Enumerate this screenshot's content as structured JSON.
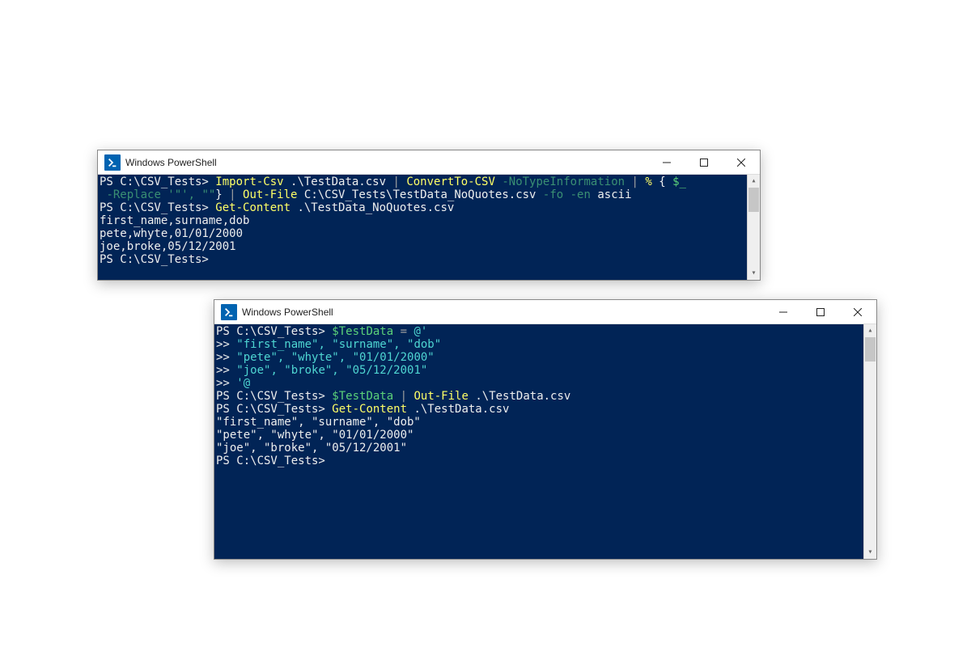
{
  "window_title": "Windows PowerShell",
  "prompt": "PS C:\\CSV_Tests>",
  "continuation_prompt": ">>",
  "windows": {
    "w1": {
      "lines": [
        {
          "type": "cmd",
          "segments": [
            {
              "cls": "ps-white",
              "t": "PS C:\\CSV_Tests> "
            },
            {
              "cls": "ps-yellow",
              "t": "Import-Csv"
            },
            {
              "cls": "ps-white",
              "t": " .\\TestData.csv "
            },
            {
              "cls": "ps-gray",
              "t": "|"
            },
            {
              "cls": "ps-white",
              "t": " "
            },
            {
              "cls": "ps-yellow",
              "t": "ConvertTo-CSV"
            },
            {
              "cls": "ps-white",
              "t": " "
            },
            {
              "cls": "ps-darkgreen",
              "t": "-NoTypeInformation "
            },
            {
              "cls": "ps-gray",
              "t": "|"
            },
            {
              "cls": "ps-white",
              "t": " "
            },
            {
              "cls": "ps-yellow",
              "t": "%"
            },
            {
              "cls": "ps-white",
              "t": " { "
            },
            {
              "cls": "ps-green",
              "t": "$_"
            }
          ]
        },
        {
          "type": "cmd",
          "segments": [
            {
              "cls": "ps-white",
              "t": " "
            },
            {
              "cls": "ps-darkgreen",
              "t": "-Replace '\"', \"\""
            },
            {
              "cls": "ps-white",
              "t": "} "
            },
            {
              "cls": "ps-gray",
              "t": "|"
            },
            {
              "cls": "ps-white",
              "t": " "
            },
            {
              "cls": "ps-yellow",
              "t": "Out-File"
            },
            {
              "cls": "ps-white",
              "t": " C:\\CSV_Tests\\TestData_NoQuotes.csv "
            },
            {
              "cls": "ps-darkgreen",
              "t": "-fo -en"
            },
            {
              "cls": "ps-white",
              "t": " ascii"
            }
          ]
        },
        {
          "type": "cmd",
          "segments": [
            {
              "cls": "ps-white",
              "t": "PS C:\\CSV_Tests> "
            },
            {
              "cls": "ps-yellow",
              "t": "Get-Content"
            },
            {
              "cls": "ps-white",
              "t": " .\\TestData_NoQuotes.csv"
            }
          ]
        },
        {
          "type": "out",
          "segments": [
            {
              "cls": "ps-white",
              "t": "first_name,surname,dob"
            }
          ]
        },
        {
          "type": "out",
          "segments": [
            {
              "cls": "ps-white",
              "t": "pete,whyte,01/01/2000"
            }
          ]
        },
        {
          "type": "out",
          "segments": [
            {
              "cls": "ps-white",
              "t": "joe,broke,05/12/2001"
            }
          ]
        },
        {
          "type": "cmd",
          "segments": [
            {
              "cls": "ps-white",
              "t": "PS C:\\CSV_Tests> "
            }
          ]
        }
      ]
    },
    "w2": {
      "lines": [
        {
          "type": "cmd",
          "segments": [
            {
              "cls": "ps-white",
              "t": "PS C:\\CSV_Tests> "
            },
            {
              "cls": "ps-green",
              "t": "$TestData"
            },
            {
              "cls": "ps-white",
              "t": " "
            },
            {
              "cls": "ps-gray",
              "t": "="
            },
            {
              "cls": "ps-white",
              "t": " "
            },
            {
              "cls": "ps-cyan",
              "t": "@'"
            }
          ]
        },
        {
          "type": "cmd",
          "segments": [
            {
              "cls": "ps-white",
              "t": ">> "
            },
            {
              "cls": "ps-cyan",
              "t": "\"first_name\", \"surname\", \"dob\""
            }
          ]
        },
        {
          "type": "cmd",
          "segments": [
            {
              "cls": "ps-white",
              "t": ">> "
            },
            {
              "cls": "ps-cyan",
              "t": "\"pete\", \"whyte\", \"01/01/2000\""
            }
          ]
        },
        {
          "type": "cmd",
          "segments": [
            {
              "cls": "ps-white",
              "t": ">> "
            },
            {
              "cls": "ps-cyan",
              "t": "\"joe\", \"broke\", \"05/12/2001\""
            }
          ]
        },
        {
          "type": "cmd",
          "segments": [
            {
              "cls": "ps-white",
              "t": ">> "
            },
            {
              "cls": "ps-cyan",
              "t": "'@"
            }
          ]
        },
        {
          "type": "cmd",
          "segments": [
            {
              "cls": "ps-white",
              "t": "PS C:\\CSV_Tests> "
            },
            {
              "cls": "ps-green",
              "t": "$TestData"
            },
            {
              "cls": "ps-white",
              "t": " "
            },
            {
              "cls": "ps-gray",
              "t": "|"
            },
            {
              "cls": "ps-white",
              "t": " "
            },
            {
              "cls": "ps-yellow",
              "t": "Out-File"
            },
            {
              "cls": "ps-white",
              "t": " .\\TestData.csv"
            }
          ]
        },
        {
          "type": "cmd",
          "segments": [
            {
              "cls": "ps-white",
              "t": "PS C:\\CSV_Tests> "
            },
            {
              "cls": "ps-yellow",
              "t": "Get-Content"
            },
            {
              "cls": "ps-white",
              "t": " .\\TestData.csv"
            }
          ]
        },
        {
          "type": "out",
          "segments": [
            {
              "cls": "ps-white",
              "t": "\"first_name\", \"surname\", \"dob\""
            }
          ]
        },
        {
          "type": "out",
          "segments": [
            {
              "cls": "ps-white",
              "t": "\"pete\", \"whyte\", \"01/01/2000\""
            }
          ]
        },
        {
          "type": "out",
          "segments": [
            {
              "cls": "ps-white",
              "t": "\"joe\", \"broke\", \"05/12/2001\""
            }
          ]
        },
        {
          "type": "cmd",
          "segments": [
            {
              "cls": "ps-white",
              "t": "PS C:\\CSV_Tests> "
            }
          ]
        }
      ]
    }
  }
}
